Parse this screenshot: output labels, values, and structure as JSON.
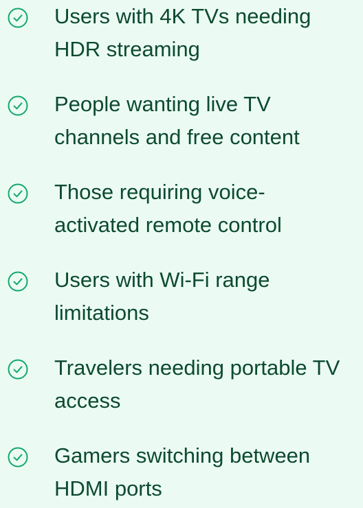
{
  "theme": {
    "background": "#ebfbf4",
    "text_color": "#0d4a30",
    "check_color": "#12a86a"
  },
  "list": {
    "items": [
      {
        "icon": "check-circle-icon",
        "line1": "Users with 4K TVs needing",
        "line2": "HDR streaming"
      },
      {
        "icon": "check-circle-icon",
        "line1": "People wanting live TV",
        "line2": "channels and free content"
      },
      {
        "icon": "check-circle-icon",
        "line1": "Those requiring voice-",
        "line2": "activated remote control"
      },
      {
        "icon": "check-circle-icon",
        "line1": "Users with Wi-Fi range",
        "line2": "limitations"
      },
      {
        "icon": "check-circle-icon",
        "line1": "Travelers needing portable TV",
        "line2": "access"
      },
      {
        "icon": "check-circle-icon",
        "line1": "Gamers switching between",
        "line2": "HDMI ports"
      }
    ]
  }
}
